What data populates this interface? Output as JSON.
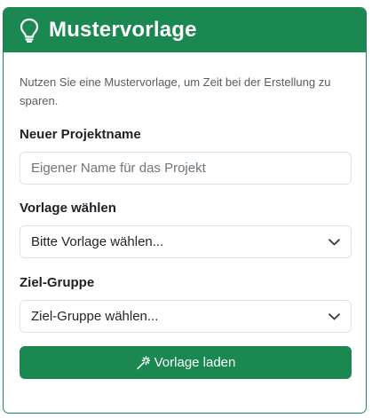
{
  "panel": {
    "title": "Mustervorlage",
    "icon": "lightbulb-icon",
    "description": "Nutzen Sie eine Mustervorlage, um Zeit bei der Erstellung zu sparen."
  },
  "form": {
    "project_name": {
      "label": "Neuer Projektname",
      "placeholder": "Eigener Name für das Projekt",
      "value": ""
    },
    "template": {
      "label": "Vorlage wählen",
      "selected": "Bitte Vorlage wählen..."
    },
    "target_group": {
      "label": "Ziel-Gruppe",
      "selected": "Ziel-Gruppe wählen..."
    },
    "load_button": {
      "label": "Vorlage laden",
      "icon": "magic-wand-icon"
    }
  },
  "colors": {
    "accent": "#1b8751",
    "input_border": "#dee2e6",
    "description_text": "#555d63"
  }
}
